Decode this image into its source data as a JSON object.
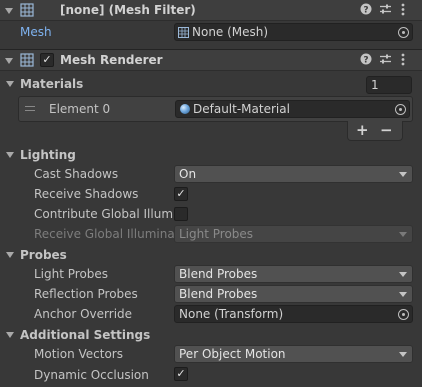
{
  "mesh_filter": {
    "title": "[none] (Mesh Filter)",
    "mesh_label": "Mesh",
    "mesh_value": "None (Mesh)"
  },
  "mesh_renderer": {
    "title": "Mesh Renderer",
    "enabled": true,
    "materials": {
      "label": "Materials",
      "count": "1",
      "element_label": "Element 0",
      "element_value": "Default-Material"
    },
    "lighting": {
      "label": "Lighting",
      "cast_shadows_label": "Cast Shadows",
      "cast_shadows_value": "On",
      "receive_shadows_label": "Receive Shadows",
      "receive_shadows": true,
      "contribute_gi_label": "Contribute Global Illumin",
      "contribute_gi": false,
      "receive_gi_label": "Receive Global Illuminati",
      "receive_gi_value": "Light Probes"
    },
    "probes": {
      "label": "Probes",
      "light_probes_label": "Light Probes",
      "light_probes_value": "Blend Probes",
      "reflection_probes_label": "Reflection Probes",
      "reflection_probes_value": "Blend Probes",
      "anchor_override_label": "Anchor Override",
      "anchor_override_value": "None (Transform)"
    },
    "additional": {
      "label": "Additional Settings",
      "motion_vectors_label": "Motion Vectors",
      "motion_vectors_value": "Per Object Motion",
      "dynamic_occlusion_label": "Dynamic Occlusion",
      "dynamic_occlusion": true
    }
  },
  "icons": {
    "help": "help-icon",
    "presets": "presets-icon",
    "menu": "kebab-menu-icon",
    "grid": "mesh-grid-icon",
    "material": "material-sphere-icon"
  },
  "checkmark": "✓",
  "colors": {
    "accent_link": "#7fb3f0",
    "background": "#383838",
    "header": "#3e3e3e",
    "field": "#2a2a2a",
    "dropdown": "#515151"
  }
}
